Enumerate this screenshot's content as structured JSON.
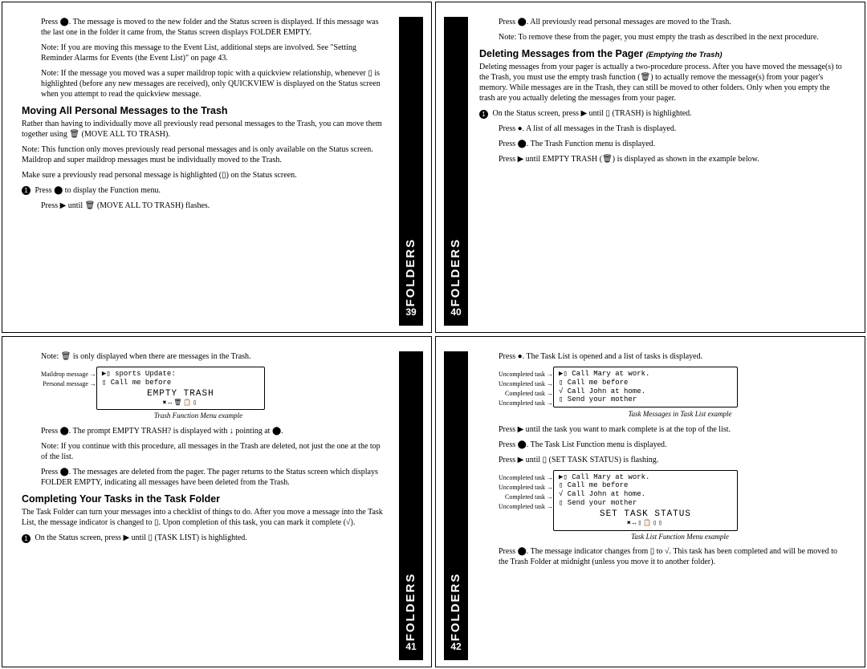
{
  "tab_label": "FOLDERS",
  "pages": {
    "p39": "39",
    "p40": "40",
    "p41": "41",
    "p42": "42"
  },
  "p39": {
    "para1": "Press ⬤. The message is moved to the new folder and the Status screen is displayed. If this message was the last one in the folder it came from, the Status screen displays FOLDER EMPTY.",
    "note1": "Note: If you are moving this message to the Event List, additional steps are involved. See \"Setting Reminder Alarms for Events (the Event List)\" on page 43.",
    "note2": "Note: If the message you moved was a super maildrop topic with a quickview relationship, whenever ▯ is highlighted (before any new messages are received), only QUICKVIEW is displayed on the Status screen when you attempt to read the quickview message.",
    "h1": "Moving All Personal Messages to the Trash",
    "para2": "Rather than having to individually move all previously read personal messages to the Trash, you can move them together using 🗑 (MOVE ALL TO TRASH).",
    "note3": "Note: This function only moves previously read personal messages and is only available on the Status screen. Maildrop and super maildrop messages must be individually moved to the Trash.",
    "para3": "Make sure a previously read personal message is highlighted (▯) on the Status screen.",
    "step1a": "Press ⬤ to display the Function menu.",
    "step1b": "Press ▶ until 🗑 (MOVE ALL TO TRASH) flashes."
  },
  "p40": {
    "para1": "Press ⬤. All previously read personal messages are moved to the Trash.",
    "note1": "Note: To remove these from the pager, you must empty the trash as described in the next procedure.",
    "h1": "Deleting Messages from the Pager",
    "h1sub": "(Emptying the Trash)",
    "para2": "Deleting messages from your pager is actually a two-procedure process. After you have moved the message(s) to the Trash, you must use the empty trash function (🗑) to actually remove the message(s) from your pager's memory. While messages are in the Trash, they can still be moved to other folders. Only when you empty the trash are you actually deleting the messages from your pager.",
    "step1a": "On the Status screen, press ▶ until ▯ (TRASH) is highlighted.",
    "step1b": "Press ●. A list of all messages in the Trash is displayed.",
    "step1c": "Press ⬤. The Trash Function menu is displayed.",
    "step1d": "Press ▶ until EMPTY TRASH (🗑) is displayed as shown in the example below."
  },
  "p41": {
    "note1": "Note: 🗑 is only displayed when there are messages in the Trash.",
    "fig_lbl1": "Maildrop message",
    "fig_lbl2": "Personal message",
    "fig_row1": "▶▯ sports   Update:",
    "fig_row2": "  ▯ Call     me    before",
    "fig_title": "EMPTY TRASH",
    "fig_icons": "✖↔🗑📋▯",
    "caption1": "Trash Function Menu example",
    "para1": "Press ⬤. The prompt EMPTY TRASH? is displayed with ↓ pointing at ⬤.",
    "note2": "Note: If you continue with this procedure, all messages in the Trash are deleted, not just the one at the top of the list.",
    "para2": "Press ⬤. The messages are deleted from the pager. The pager returns to the Status screen which displays FOLDER EMPTY, indicating all messages have been deleted from the Trash.",
    "h1": "Completing Your Tasks in the Task Folder",
    "para3": "The Task Folder can turn your messages into a checklist of things to do. After you move a message into the Task List, the message indicator is changed to ▯. Upon completion of this task, you can mark it complete (√).",
    "step1a": "On the Status screen, press ▶ until ▯ (TASK LIST) is highlighted."
  },
  "p42": {
    "para1": "Press ●. The Task List is opened and a list of tasks is displayed.",
    "fig1_lbl1": "Uncompleted task",
    "fig1_lbl2": "Uncompleted task",
    "fig1_lbl3": "Completed task",
    "fig1_lbl4": "Uncompleted task",
    "fig1_r1": "▶▯ Call   Mary    at     work.",
    "fig1_r2": "  ▯ Call   me      before",
    "fig1_r3": "  √ Call   John    at     home.",
    "fig1_r4": "  ▯ Send   your    mother",
    "caption1": "Task Messages in Task List example",
    "para2": "Press ▶ until the task you want to mark complete is at the top of the list.",
    "para3": "Press ⬤. The Task List Function menu is displayed.",
    "para4": "Press ▶ until ▯ (SET TASK STATUS) is flashing.",
    "fig2_lbl1": "Uncompleted task",
    "fig2_lbl2": "Uncompleted task",
    "fig2_lbl3": "Completed task",
    "fig2_lbl4": "Uncompleted task",
    "fig2_r1": "▶▯ Call   Mary    at     work.",
    "fig2_r2": "  ▯ Call   me      before",
    "fig2_r3": "  √ Call   John    at     home.",
    "fig2_r4": "  ▯ Send   your    mother",
    "fig2_title": "SET TASK STATUS",
    "fig2_icons": "✖↔▯📋▯▯",
    "caption2": "Task List Function Menu example",
    "para5": "Press ⬤. The message indicator changes from ▯ to √. This task has been completed and will be moved to the Trash Folder at midnight (unless you move it to another folder)."
  }
}
